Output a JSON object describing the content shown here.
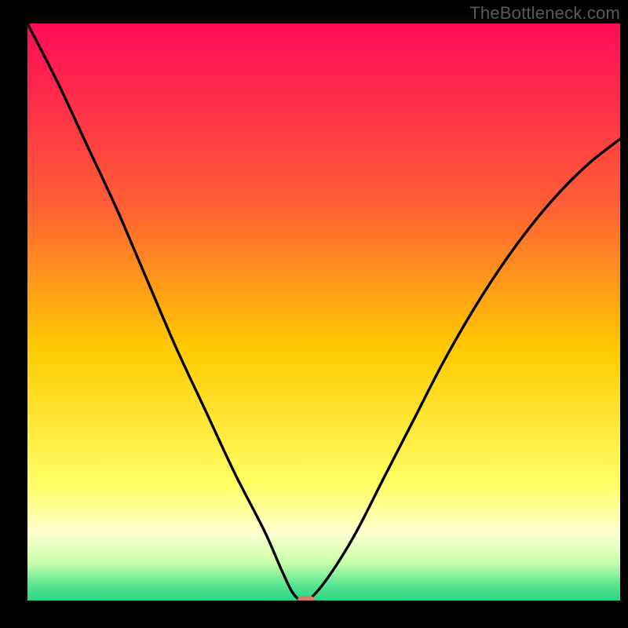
{
  "watermark": "TheBottleneck.com",
  "chart_data": {
    "type": "line",
    "title": "",
    "xlabel": "",
    "ylabel": "",
    "xlim": [
      0,
      100
    ],
    "ylim": [
      0,
      100
    ],
    "x": [
      0,
      5,
      10,
      15,
      20,
      25,
      30,
      35,
      40,
      43,
      45,
      47,
      50,
      55,
      60,
      65,
      70,
      75,
      80,
      85,
      90,
      95,
      100
    ],
    "values": [
      100,
      90,
      79,
      68,
      56,
      44,
      33,
      22,
      12,
      5,
      1,
      0,
      3,
      11,
      21,
      31,
      41,
      50,
      58,
      65,
      71,
      76,
      80
    ],
    "gradient_stops": [
      {
        "offset": 0,
        "color": "#ff0a58"
      },
      {
        "offset": 30,
        "color": "#ff5d36"
      },
      {
        "offset": 55,
        "color": "#ffca00"
      },
      {
        "offset": 78,
        "color": "#ffff66"
      },
      {
        "offset": 86,
        "color": "#ffffd0"
      },
      {
        "offset": 91,
        "color": "#c7ffa8"
      },
      {
        "offset": 95,
        "color": "#52e28f"
      },
      {
        "offset": 100,
        "color": "#00c878"
      }
    ],
    "marker": {
      "x": 47,
      "y": 0
    }
  }
}
